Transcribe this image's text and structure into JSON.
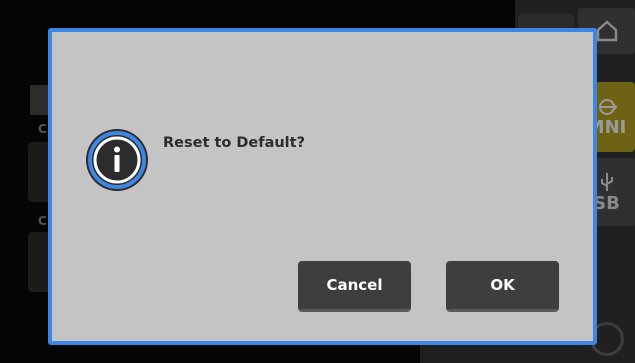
{
  "background": {
    "right_buttons": [
      {
        "name": "home",
        "icon": "home-icon",
        "label": ""
      },
      {
        "name": "omni",
        "icon": "omni-icon",
        "label": "MNI"
      },
      {
        "name": "usb",
        "icon": "usb-icon",
        "label": "SB"
      }
    ],
    "left_labels": [
      "C",
      "C"
    ]
  },
  "dialog": {
    "icon": "info-icon",
    "message": "Reset to Default?",
    "cancel_label": "Cancel",
    "ok_label": "OK",
    "border_color": "#3e86e6",
    "background_color": "#c4c4c4"
  }
}
